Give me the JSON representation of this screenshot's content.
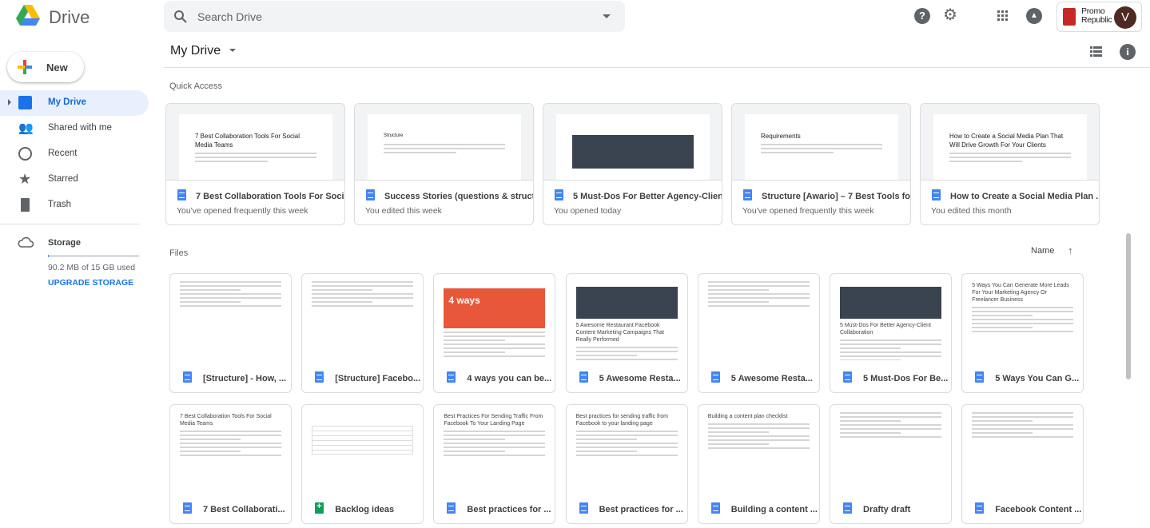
{
  "app": {
    "name": "Drive"
  },
  "search": {
    "placeholder": "Search Drive"
  },
  "account": {
    "brand": "Promo Republic",
    "avatar_letter": "V"
  },
  "header": {
    "title": "My Drive"
  },
  "sidebar": {
    "new_label": "New",
    "items": [
      {
        "label": "My Drive",
        "icon": "my-drive-icon",
        "active": true
      },
      {
        "label": "Shared with me",
        "icon": "people-icon"
      },
      {
        "label": "Recent",
        "icon": "clock-icon"
      },
      {
        "label": "Starred",
        "icon": "star-icon"
      },
      {
        "label": "Trash",
        "icon": "trash-icon"
      }
    ],
    "storage": {
      "label": "Storage",
      "usage": "90.2 MB of 15 GB used",
      "upgrade": "UPGRADE STORAGE",
      "used_fraction": 0.006
    }
  },
  "quick_access": {
    "heading": "Quick Access",
    "items": [
      {
        "name": "7 Best Collaboration Tools For Soci...",
        "sub": "You've opened frequently this week",
        "preview": "7 Best Collaboration Tools For Social Media Teams"
      },
      {
        "name": "Success Stories (questions & struct...",
        "sub": "You edited this week",
        "preview": "Structure"
      },
      {
        "name": "5 Must-Dos For Better Agency-Client...",
        "sub": "You opened today",
        "preview": ""
      },
      {
        "name": "Structure [Awario] – 7 Best Tools fo...",
        "sub": "You've opened frequently this week",
        "preview": "Requirements"
      },
      {
        "name": "How to Create a Social Media Plan ...",
        "sub": "You edited this month",
        "preview": "How to Create a Social Media Plan That Will Drive Growth For Your Clients"
      }
    ]
  },
  "files": {
    "heading": "Files",
    "sort_label": "Name",
    "items": [
      {
        "name": "[Structure] - How, ...",
        "type": "doc",
        "preview": ""
      },
      {
        "name": "[Structure] Facebo...",
        "type": "doc",
        "preview": ""
      },
      {
        "name": "4 ways you can be...",
        "type": "doc",
        "preview": "4 ways"
      },
      {
        "name": "5 Awesome Resta...",
        "type": "doc",
        "preview": "5 Awesome Restaurant Facebook Content Marketing Campaigns That Really Performed"
      },
      {
        "name": "5 Awesome Resta...",
        "type": "doc",
        "preview": ""
      },
      {
        "name": "5 Must-Dos For Be...",
        "type": "doc",
        "preview": "5 Must-Dos For Better Agency-Client Collaboration"
      },
      {
        "name": "5 Ways You Can G...",
        "type": "doc",
        "preview": "5 Ways You Can Generate More Leads For Your Marketing Agency Or Freelancer Business"
      },
      {
        "name": "7 Best Collaborati...",
        "type": "doc",
        "preview": "7 Best Collaboration Tools For Social Media Teams"
      },
      {
        "name": "Backlog ideas",
        "type": "sheet",
        "preview": ""
      },
      {
        "name": "Best practices for ...",
        "type": "doc",
        "preview": "Best Practices For Sending Traffic From Facebook To Your Landing Page"
      },
      {
        "name": "Best practices for ...",
        "type": "doc",
        "preview": "Best practices for sending traffic from Facebook to your landing page"
      },
      {
        "name": "Building a content ...",
        "type": "doc",
        "preview": "Building a content plan checklist"
      },
      {
        "name": "Drafty draft",
        "type": "doc",
        "preview": ""
      },
      {
        "name": "Facebook Content ...",
        "type": "doc",
        "preview": ""
      }
    ]
  },
  "colors": {
    "accent": "#1967d2",
    "active_bg": "#e8f0fe",
    "doc": "#4285f4",
    "sheet": "#0f9d58",
    "brand": "#c62828"
  }
}
